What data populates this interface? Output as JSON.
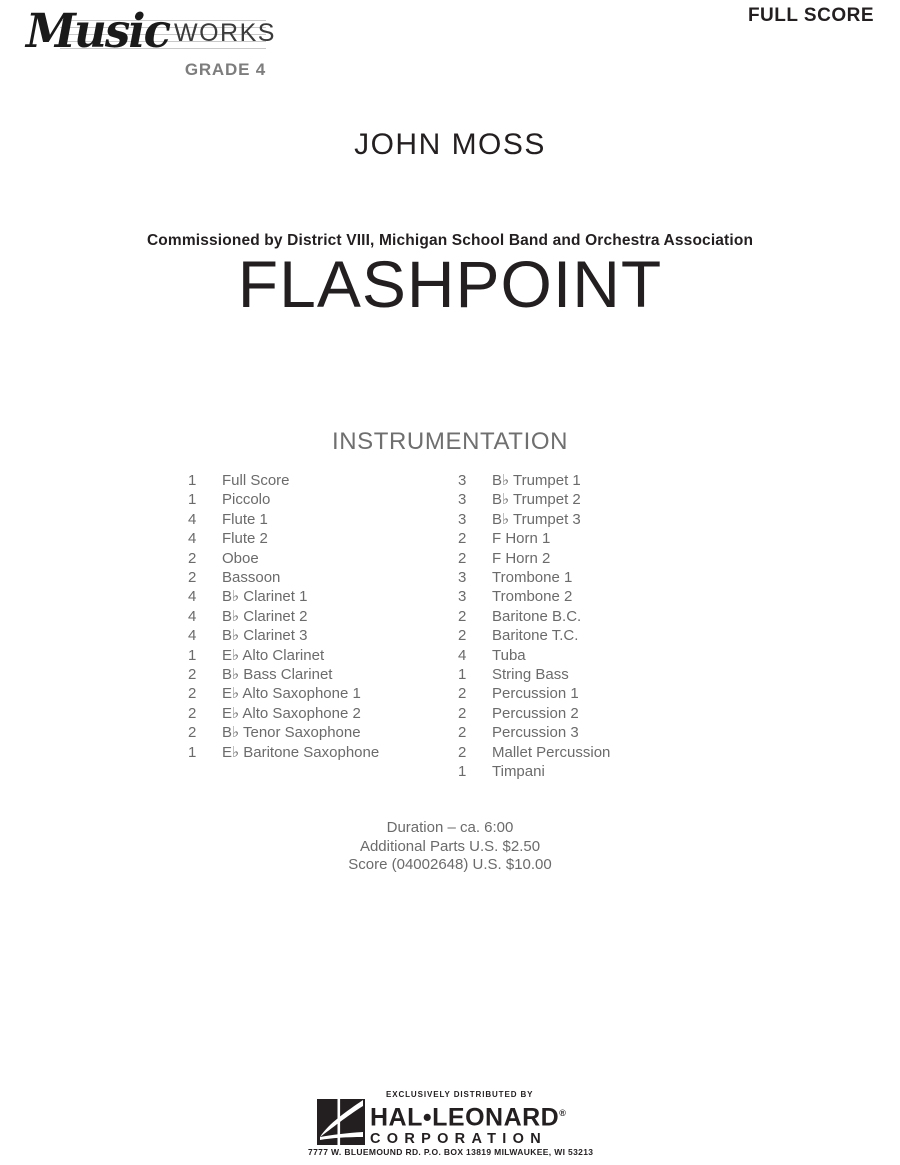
{
  "header": {
    "full_score_label": "FULL SCORE",
    "logo": {
      "music_text": "Music",
      "works_text": "WORKS",
      "grade_text": "GRADE 4"
    }
  },
  "composer": "JOHN MOSS",
  "commission": "Commissioned by District VIII, Michigan School Band and Orchestra Association",
  "title": "FLASHPOINT",
  "instrumentation": {
    "heading": "INSTRUMENTATION",
    "left_column": [
      {
        "qty": "1",
        "name": "Full Score"
      },
      {
        "qty": "1",
        "name": "Piccolo"
      },
      {
        "qty": "4",
        "name": "Flute 1"
      },
      {
        "qty": "4",
        "name": "Flute 2"
      },
      {
        "qty": "2",
        "name": "Oboe"
      },
      {
        "qty": "2",
        "name": "Bassoon"
      },
      {
        "qty": "4",
        "name": "B♭ Clarinet 1"
      },
      {
        "qty": "4",
        "name": "B♭ Clarinet 2"
      },
      {
        "qty": "4",
        "name": "B♭ Clarinet 3"
      },
      {
        "qty": "1",
        "name": "E♭ Alto Clarinet"
      },
      {
        "qty": "2",
        "name": "B♭ Bass Clarinet"
      },
      {
        "qty": "2",
        "name": "E♭ Alto Saxophone 1"
      },
      {
        "qty": "2",
        "name": "E♭ Alto Saxophone 2"
      },
      {
        "qty": "2",
        "name": "B♭ Tenor Saxophone"
      },
      {
        "qty": "1",
        "name": "E♭ Baritone Saxophone"
      }
    ],
    "right_column": [
      {
        "qty": "3",
        "name": "B♭ Trumpet 1"
      },
      {
        "qty": "3",
        "name": "B♭ Trumpet 2"
      },
      {
        "qty": "3",
        "name": "B♭ Trumpet 3"
      },
      {
        "qty": "2",
        "name": "F Horn 1"
      },
      {
        "qty": "2",
        "name": "F Horn 2"
      },
      {
        "qty": "3",
        "name": "Trombone 1"
      },
      {
        "qty": "3",
        "name": "Trombone 2"
      },
      {
        "qty": "2",
        "name": "Baritone B.C."
      },
      {
        "qty": "2",
        "name": "Baritone T.C."
      },
      {
        "qty": "4",
        "name": "Tuba"
      },
      {
        "qty": "1",
        "name": "String Bass"
      },
      {
        "qty": "2",
        "name": "Percussion 1"
      },
      {
        "qty": "2",
        "name": "Percussion 2"
      },
      {
        "qty": "2",
        "name": "Percussion 3"
      },
      {
        "qty": "2",
        "name": "Mallet Percussion"
      },
      {
        "qty": "1",
        "name": "Timpani"
      }
    ]
  },
  "price_block": {
    "duration": "Duration – ca. 6:00",
    "additional_parts": "Additional Parts U.S. $2.50",
    "score_price": "Score (04002648) U.S. $10.00"
  },
  "footer": {
    "distributed_by": "EXCLUSIVELY DISTRIBUTED BY",
    "publisher": "HAL•LEONARD",
    "registered_mark": "®",
    "corporation": "CORPORATION",
    "address": "7777 W. BLUEMOUND RD. P.O. BOX 13819 MILWAUKEE, WI 53213"
  },
  "colors": {
    "text": "#231f20",
    "gray_text": "#6b6b6b",
    "heading_gray": "#6f6f6f",
    "grade_gray": "#7d7d7d",
    "staff_line": "#c9c9c9"
  }
}
